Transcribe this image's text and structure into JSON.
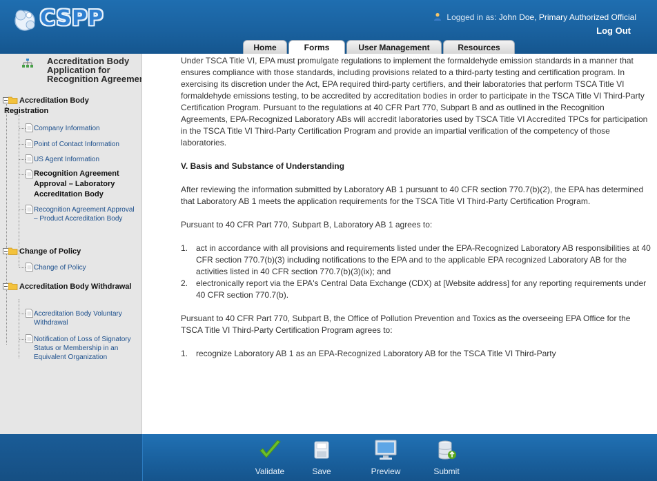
{
  "app": {
    "logo_text": "CSPP"
  },
  "header": {
    "logged_in_prefix": "Logged in as:",
    "logged_in_user": "John Doe, Primary Authorized Official",
    "logout_label": "Log Out"
  },
  "tabs": [
    {
      "label": "Home"
    },
    {
      "label": "Forms"
    },
    {
      "label": "User Management"
    },
    {
      "label": "Resources"
    }
  ],
  "sidebar": {
    "title": "Accreditation Body Application for Recognition Agreement",
    "groups": [
      {
        "label": "Accreditation Body Registration",
        "items": [
          {
            "label": "Company Information"
          },
          {
            "label": "Point of Contact Information"
          },
          {
            "label": "US Agent Information"
          },
          {
            "label": "Recognition Agreement Approval – Laboratory Accreditation Body",
            "current": true
          },
          {
            "label": "Recognition Agreement Approval – Product Accreditation Body"
          }
        ]
      },
      {
        "label": "Change of Policy",
        "items": [
          {
            "label": "Change of Policy"
          }
        ]
      },
      {
        "label": "Accreditation Body Withdrawal",
        "items": [
          {
            "label": "Accreditation Body Voluntary Withdrawal"
          },
          {
            "label": "Notification of Loss of Signatory Status or Membership in an Equivalent Organization"
          }
        ]
      }
    ]
  },
  "content": {
    "para1": "Under TSCA Title VI, EPA must promulgate regulations to implement the formaldehyde emission standards in a manner that ensures compliance with those standards, including provisions related to a third-party testing and certification program. In exercising its discretion under the Act, EPA required third-party certifiers, and their laboratories that perform TSCA Title VI formaldehyde emissions testing, to be accredited by accreditation bodies in order to participate in the TSCA Title VI Third-Party Certification Program. Pursuant to the regulations at 40 CFR Part 770, Subpart B and as outlined in the Recognition Agreements, EPA-Recognized Laboratory ABs will accredit laboratories used by TSCA Title VI Accredited TPCs for participation in the TSCA Title VI Third-Party Certification Program and provide an impartial verification of the competency of those laboratories.",
    "section_heading": "V. Basis and Substance of Understanding",
    "para2": "After reviewing the information submitted by Laboratory AB 1 pursuant to 40 CFR section 770.7(b)(2), the EPA has determined that Laboratory AB 1 meets the application requirements for the TSCA Title VI Third-Party Certification Program.",
    "para3": "Pursuant to 40 CFR Part 770, Subpart B, Laboratory AB 1 agrees to:",
    "list1": [
      {
        "num": "1.",
        "text": "act in accordance with all provisions and requirements listed under the EPA-Recognized Laboratory AB responsibilities at 40 CFR section 770.7(b)(3) including notifications to the EPA and to the applicable EPA recognized Laboratory AB for the activities listed in 40 CFR section 770.7(b)(3)(ix); and"
      },
      {
        "num": "2.",
        "text": "electronically report via the EPA's Central Data Exchange (CDX) at [Website address] for any reporting requirements under 40 CFR section 770.7(b)."
      }
    ],
    "para4": "Pursuant to 40 CFR Part 770, Subpart B, the Office of Pollution Prevention and Toxics as the overseeing EPA Office for the TSCA Title VI Third-Party Certification Program agrees to:",
    "list2": [
      {
        "num": "1.",
        "text": "recognize Laboratory AB 1 as an EPA-Recognized Laboratory AB for the TSCA Title VI Third-Party"
      }
    ]
  },
  "footer": {
    "buttons": [
      {
        "label": "Validate",
        "icon": "checkmark-icon"
      },
      {
        "label": "Save",
        "icon": "floppy-disk-icon"
      },
      {
        "label": "Preview",
        "icon": "monitor-icon"
      },
      {
        "label": "Submit",
        "icon": "database-upload-icon"
      }
    ]
  },
  "colors": {
    "header_blue": "#1a62a0",
    "footer_blue": "#195f9c",
    "sidebar_bg": "#e6e6e6",
    "link_blue": "#1c4f8c",
    "validate_green": "#5aa81f"
  }
}
